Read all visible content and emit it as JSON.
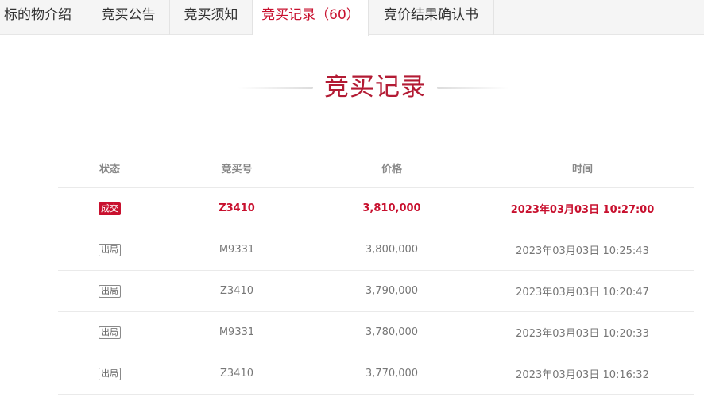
{
  "tabs": [
    {
      "label": "标的物介绍"
    },
    {
      "label": "竞买公告"
    },
    {
      "label": "竞买须知"
    },
    {
      "label": "竞买记录（60）",
      "active": true
    },
    {
      "label": "竞价结果确认书"
    }
  ],
  "section": {
    "title": "竞买记录"
  },
  "table": {
    "headers": {
      "status": "状态",
      "bid_number": "竞买号",
      "price": "价格",
      "time": "时间"
    },
    "rows": [
      {
        "status": "成交",
        "bid_number": "Z3410",
        "price": "3,810,000",
        "time": "2023年03月03日 10:27:00"
      },
      {
        "status": "出局",
        "bid_number": "M9331",
        "price": "3,800,000",
        "time": "2023年03月03日 10:25:43"
      },
      {
        "status": "出局",
        "bid_number": "Z3410",
        "price": "3,790,000",
        "time": "2023年03月03日 10:20:47"
      },
      {
        "status": "出局",
        "bid_number": "M9331",
        "price": "3,780,000",
        "time": "2023年03月03日 10:20:33"
      },
      {
        "status": "出局",
        "bid_number": "Z3410",
        "price": "3,770,000",
        "time": "2023年03月03日 10:16:32"
      }
    ]
  },
  "colors": {
    "accent": "#c8102e",
    "title": "#b31b34",
    "text_muted": "#777777",
    "tabbar_bg": "#f5f5f5"
  }
}
